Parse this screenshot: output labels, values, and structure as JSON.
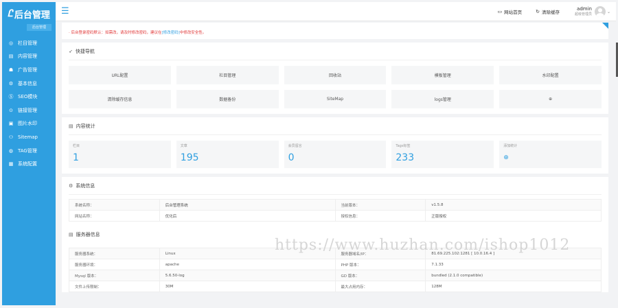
{
  "sidebar": {
    "logo": "后台管理",
    "logo_sub": "后台管理",
    "items": [
      {
        "icon": "grid-icon",
        "glyph": "◎",
        "label": "栏目管理"
      },
      {
        "icon": "doc-icon",
        "glyph": "▤",
        "label": "内容管理"
      },
      {
        "icon": "ad-icon",
        "glyph": "☗",
        "label": "广告管理"
      },
      {
        "icon": "settings-icon",
        "glyph": "⚙",
        "label": "基本信息"
      },
      {
        "icon": "seo-icon",
        "glyph": "Ⓢ",
        "label": "SEO模块"
      },
      {
        "icon": "link-icon",
        "glyph": "⊙",
        "label": "链接管理"
      },
      {
        "icon": "image-icon",
        "glyph": "▣",
        "label": "图片水印"
      },
      {
        "icon": "sitemap-icon",
        "glyph": "⚇",
        "label": "Sitemap"
      },
      {
        "icon": "tag-icon",
        "glyph": "◍",
        "label": "TAG管理"
      },
      {
        "icon": "config-icon",
        "glyph": "▦",
        "label": "系统配置"
      }
    ]
  },
  "topbar": {
    "home_label": "网站首页",
    "clear_cache_label": "清除缓存",
    "user_name": "admin",
    "user_role": "超级管理员"
  },
  "notice": {
    "text": "· 后台登录密码默认：如需改，请及时修改密码，建议在",
    "link": "[修改密码]",
    "tail": "中修改安全性。"
  },
  "quick_nav": {
    "title": "快捷导航",
    "buttons": [
      "URL配置",
      "栏目管理",
      "回收站",
      "模板管理",
      "水印配置",
      "清除缓存信息",
      "数据备份",
      "SiteMap",
      "logs管理",
      "⊕"
    ]
  },
  "stats": {
    "title": "内容统计",
    "items": [
      {
        "label": "栏目",
        "value": "1"
      },
      {
        "label": "文章",
        "value": "195"
      },
      {
        "label": "会员留言",
        "value": "0"
      },
      {
        "label": "Tags标签",
        "value": "233"
      },
      {
        "label": "添加统计",
        "value": "⊕"
      }
    ]
  },
  "system": {
    "title": "系统信息",
    "rows": [
      [
        "系统名称：",
        "后台管理系统",
        "当前版本：",
        "v1.5.8"
      ],
      [
        "网站名称：",
        "优化后",
        "授权信息：",
        "正版授权"
      ]
    ]
  },
  "server": {
    "title": "服务器信息",
    "rows": [
      [
        "服务器系统：",
        "Linux",
        "服务器域名/IP：",
        "81.69.225.102:1281 [ 10.0.16.4 ]"
      ],
      [
        "服务器环境：",
        "apache",
        "PHP 版本：",
        "7.1.33"
      ],
      [
        "Mysql 版本：",
        "5.6.50-log",
        "GD 版本：",
        "bundled (2.1.0 compatible)"
      ],
      [
        "文件上传限制：",
        "30M",
        "最大占用内存：",
        "128M"
      ]
    ]
  },
  "watermark": "https://www.huzhan.com/ishop1012"
}
